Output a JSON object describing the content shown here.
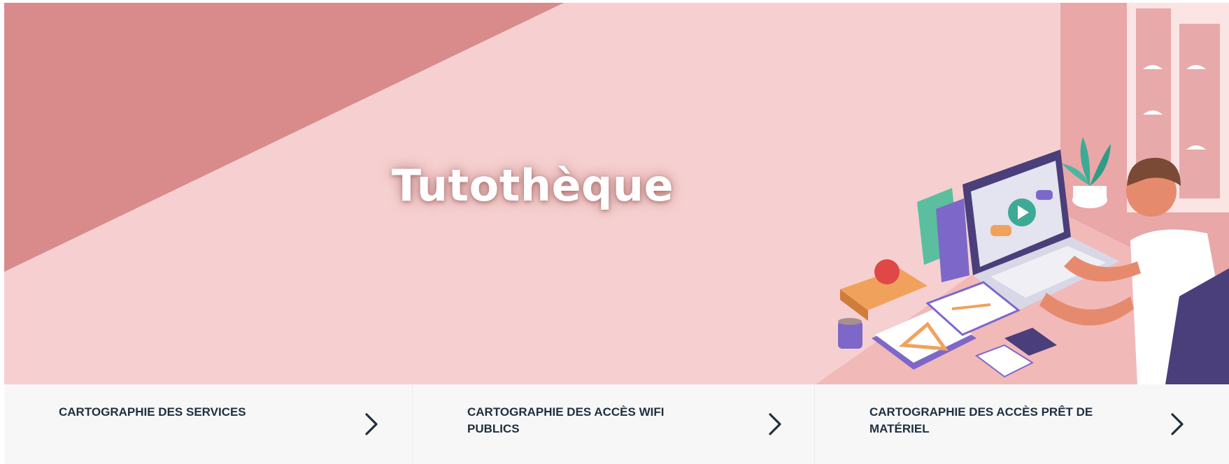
{
  "hero": {
    "title": "Tutothèque",
    "illustration_icon": "person-at-laptop-desk-illustration",
    "colors": {
      "background": "#f6d0d0",
      "accent_wall": "#d98b8b",
      "desk": "#f2b9b9"
    }
  },
  "cards": [
    {
      "label": "CARTOGRAPHIE DES SERVICES",
      "icon": "chevron-right-icon"
    },
    {
      "label": "CARTOGRAPHIE DES ACCÈS WIFI PUBLICS",
      "icon": "chevron-right-icon"
    },
    {
      "label": "CARTOGRAPHIE DES ACCÈS PRÊT DE MATÉRIEL",
      "icon": "chevron-right-icon"
    }
  ],
  "colors": {
    "card_background": "#f7f7f7",
    "card_text": "#1f2f3f"
  }
}
